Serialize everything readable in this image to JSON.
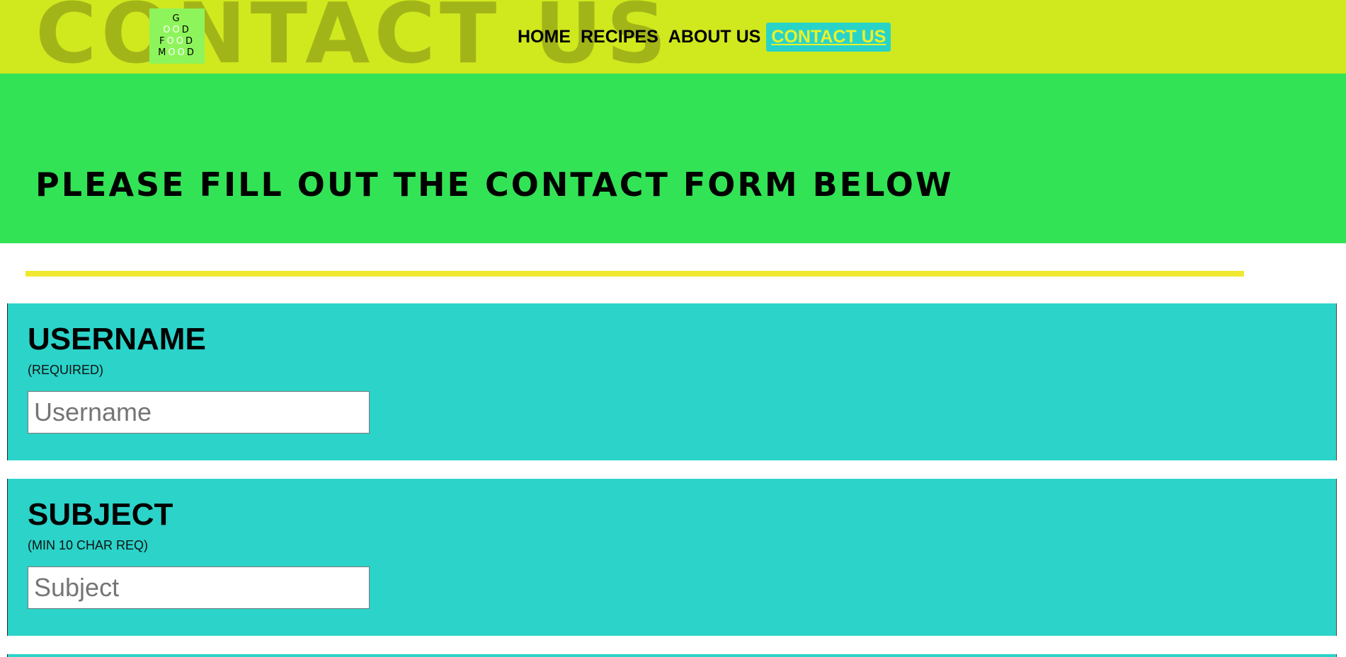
{
  "header": {
    "big_title": "CONTACT US",
    "logo": {
      "line1": [
        "G",
        "O",
        "O",
        "D"
      ],
      "line2": [
        "F",
        "O",
        "O",
        "D"
      ],
      "line3": [
        "M",
        "O",
        "O",
        "D"
      ]
    },
    "nav": [
      {
        "label": "HOME",
        "active": false
      },
      {
        "label": "RECIPES",
        "active": false
      },
      {
        "label": "ABOUT US",
        "active": false
      },
      {
        "label": "CONTACT US",
        "active": true
      }
    ]
  },
  "hero": {
    "subtitle": "PLEASE FILL OUT THE CONTACT FORM BELOW"
  },
  "form": {
    "username": {
      "label": "USERNAME",
      "requirement": "(REQUIRED)",
      "value": "",
      "placeholder": "Username"
    },
    "subject": {
      "label": "SUBJECT",
      "requirement": "(MIN 10 CHAR REQ)",
      "value": "",
      "placeholder": "Subject"
    }
  },
  "colors": {
    "header_bg": "#d0e81f",
    "hero_bg": "#33e356",
    "form_bg": "#2bd3c9",
    "divider": "#f0e830",
    "logo_bg": "#8df55b",
    "active_nav_text": "#e9f22a"
  }
}
